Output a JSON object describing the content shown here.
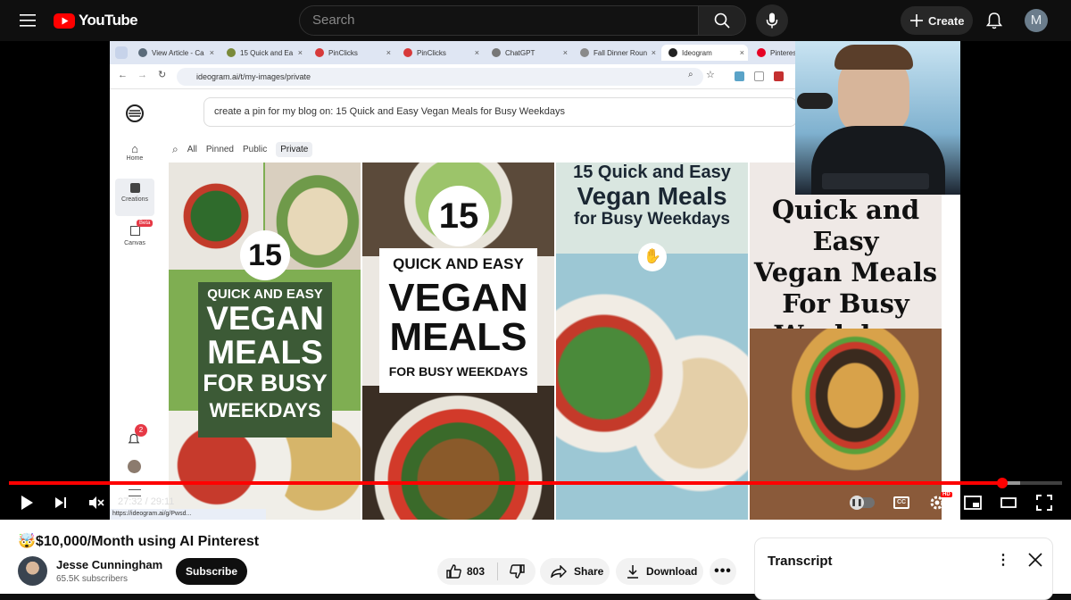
{
  "topbar": {
    "logo_text": "YouTube",
    "search_placeholder": "Search",
    "create_label": "Create",
    "avatar_letter": "M",
    "icons": [
      "menu-icon",
      "youtube-logo-icon",
      "search-icon",
      "mic-icon",
      "plus-icon",
      "bell-icon"
    ]
  },
  "browser": {
    "tabs": [
      {
        "label": "View Article - Ca",
        "color": "#5b6b7a"
      },
      {
        "label": "15 Quick and Ea",
        "color": "#7a8a3a"
      },
      {
        "label": "PinClicks",
        "color": "#d73a3a"
      },
      {
        "label": "PinClicks",
        "color": "#d73a3a"
      },
      {
        "label": "ChatGPT",
        "color": "#777777"
      },
      {
        "label": "Fall Dinner Roun",
        "color": "#8a8a8a"
      },
      {
        "label": "Ideogram",
        "color": "#222222"
      },
      {
        "label": "Pinterest",
        "color": "#e60023"
      }
    ],
    "active_tab_index": 6,
    "url": "ideogram.ai/t/my-images/private"
  },
  "ideogram": {
    "nav": [
      {
        "label": "Home"
      },
      {
        "label": "Creations"
      },
      {
        "label": "Canvas",
        "badge": "Beta"
      }
    ],
    "notif_count": "2",
    "prompt": "create a pin for my blog on: 15 Quick and Easy Vegan Meals for Busy Weekdays",
    "filters": [
      "All",
      "Pinned",
      "Public",
      "Private"
    ],
    "active_filter": "Private",
    "status_url": "https://ideogram.ai/g/Pwsd...",
    "images": [
      {
        "number": "15",
        "line1": "QUICK AND EASY",
        "line2": "VEGAN",
        "line3": "MEALS",
        "line4": "FOR BUSY",
        "line5": "WEEKDAYS"
      },
      {
        "number": "15",
        "line1": "QUICK AND EASY",
        "line2": "VEGAN",
        "line3": "MEALS",
        "line4": "FOR BUSY WEEKDAYS"
      },
      {
        "line1": "15 Quick and Easy",
        "line2": "Vegan Meals",
        "line3": "for Busy Weekdays"
      },
      {
        "line1": "Quick and Easy",
        "line2": "Vegan Meals",
        "line3": "For Busy",
        "line4": "Weekdays"
      }
    ]
  },
  "player": {
    "current_time": "27:32",
    "duration": "29:11",
    "progress_fraction": 0.943,
    "buffered_fraction": 0.96,
    "hd_badge": "HD",
    "accent": "#ff0000"
  },
  "video": {
    "title": "🤯$10,000/Month using AI Pinterest",
    "channel": "Jesse Cunningham",
    "subscribers": "65.5K subscribers",
    "subscribe_label": "Subscribe",
    "likes": "803",
    "share_label": "Share",
    "download_label": "Download"
  },
  "transcript": {
    "title": "Transcript"
  }
}
